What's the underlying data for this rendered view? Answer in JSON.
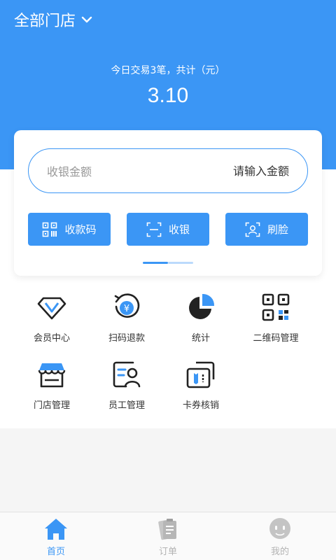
{
  "header": {
    "store_select": "全部门店",
    "summary_text": "今日交易3笔，共计（元）",
    "summary_amount": "3.10"
  },
  "card": {
    "amount_label": "收银金额",
    "amount_placeholder": "请输入金额",
    "buttons": [
      {
        "label": "收款码",
        "icon": "qr-code-icon"
      },
      {
        "label": "收银",
        "icon": "scan-icon"
      },
      {
        "label": "刷脸",
        "icon": "face-scan-icon"
      }
    ]
  },
  "grid": [
    {
      "label": "会员中心",
      "icon": "diamond-icon"
    },
    {
      "label": "扫码退款",
      "icon": "refund-icon"
    },
    {
      "label": "统计",
      "icon": "pie-chart-icon"
    },
    {
      "label": "二维码管理",
      "icon": "qr-code-icon"
    },
    {
      "label": "门店管理",
      "icon": "store-icon"
    },
    {
      "label": "员工管理",
      "icon": "staff-icon"
    },
    {
      "label": "卡券核销",
      "icon": "coupon-icon"
    }
  ],
  "tabbar": [
    {
      "label": "首页",
      "active": true,
      "icon": "home-icon"
    },
    {
      "label": "订单",
      "active": false,
      "icon": "order-icon"
    },
    {
      "label": "我的",
      "active": false,
      "icon": "profile-icon"
    }
  ],
  "colors": {
    "primary": "#3b96f5",
    "text": "#333333",
    "inactive": "#b3b3b3"
  },
  "indicator": {
    "active_index": 0,
    "count": 2
  }
}
